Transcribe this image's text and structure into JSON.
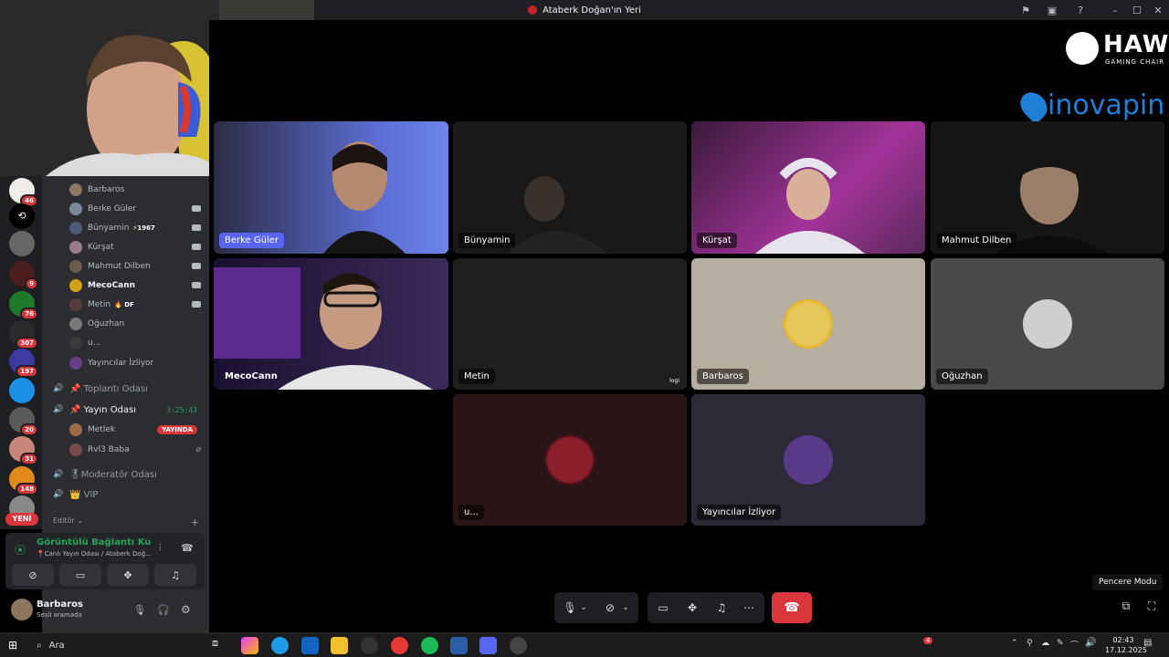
{
  "window": {
    "title": "Ataberk Doğan'ın Yeri"
  },
  "servers": [
    {
      "badge": "46"
    },
    {
      "badge": ""
    },
    {
      "badge": ""
    },
    {
      "badge": "9"
    },
    {
      "badge": "76"
    },
    {
      "badge": "307"
    },
    {
      "badge": "197"
    },
    {
      "badge": ""
    },
    {
      "badge": "20"
    },
    {
      "badge": "31"
    },
    {
      "badge": "148"
    },
    {
      "badge": ""
    }
  ],
  "new_label": "YENİ",
  "members": [
    {
      "name": "Barbaros",
      "tag": "",
      "cam": false
    },
    {
      "name": "Berke Güler",
      "tag": "",
      "cam": true
    },
    {
      "name": "Bünyamin",
      "tag": "⚡1967",
      "cam": true
    },
    {
      "name": "Kürşat",
      "tag": "",
      "cam": true
    },
    {
      "name": "Mahmut Dilben",
      "tag": "",
      "cam": true
    },
    {
      "name": "MecoCann",
      "tag": "",
      "cam": true
    },
    {
      "name": "Metin",
      "tag": "🔥 DF",
      "cam": true
    },
    {
      "name": "Oğuzhan",
      "tag": "",
      "cam": false
    },
    {
      "name": "u...",
      "tag": "",
      "cam": false
    },
    {
      "name": "Yayıncılar İzliyor",
      "tag": "",
      "cam": false
    }
  ],
  "voice_channels": {
    "toplanti": "📌 Toplantı Odası",
    "yayin": "📌 Yayın Odası",
    "yayin_timer": "3:25:43",
    "yayin_members": [
      {
        "name": "Metlek",
        "live": "YAYINDA"
      },
      {
        "name": "Rvl3 Baba",
        "live": ""
      }
    ],
    "moderator": "🎖Moderatör Odası",
    "vip": "👑 VIP"
  },
  "editor_label": "Editör ⌄",
  "voice_panel": {
    "status": "Görüntülü Bağlantı Kuruldu",
    "sub": "📍Canlı Yayın Odası / Ataberk Doğ..."
  },
  "user": {
    "name": "Barbaros",
    "status": "Sesli aramada"
  },
  "tiles": [
    {
      "name": "Berke Güler"
    },
    {
      "name": "Bünyamin"
    },
    {
      "name": "Kürşat"
    },
    {
      "name": "Mahmut Dilben"
    },
    {
      "name": "MecoCann"
    },
    {
      "name": "Metin"
    },
    {
      "name": "Barbaros"
    },
    {
      "name": "Oğuzhan"
    },
    {
      "name": "u..."
    },
    {
      "name": "Yayıncılar İzliyor"
    }
  ],
  "metin_tile_corner": "logi",
  "sponsors": {
    "hawk": "HAWK",
    "hawk_sub": "GAMING CHAIR",
    "inovapin": "inovapin"
  },
  "tooltip": "Pencere Modu",
  "taskbar": {
    "search": "Ara",
    "time": "02:43",
    "date": "17.12.2025",
    "notif": "4"
  },
  "colors": {
    "accent": "#23a55a",
    "danger": "#da373c",
    "bg": "#000000"
  }
}
